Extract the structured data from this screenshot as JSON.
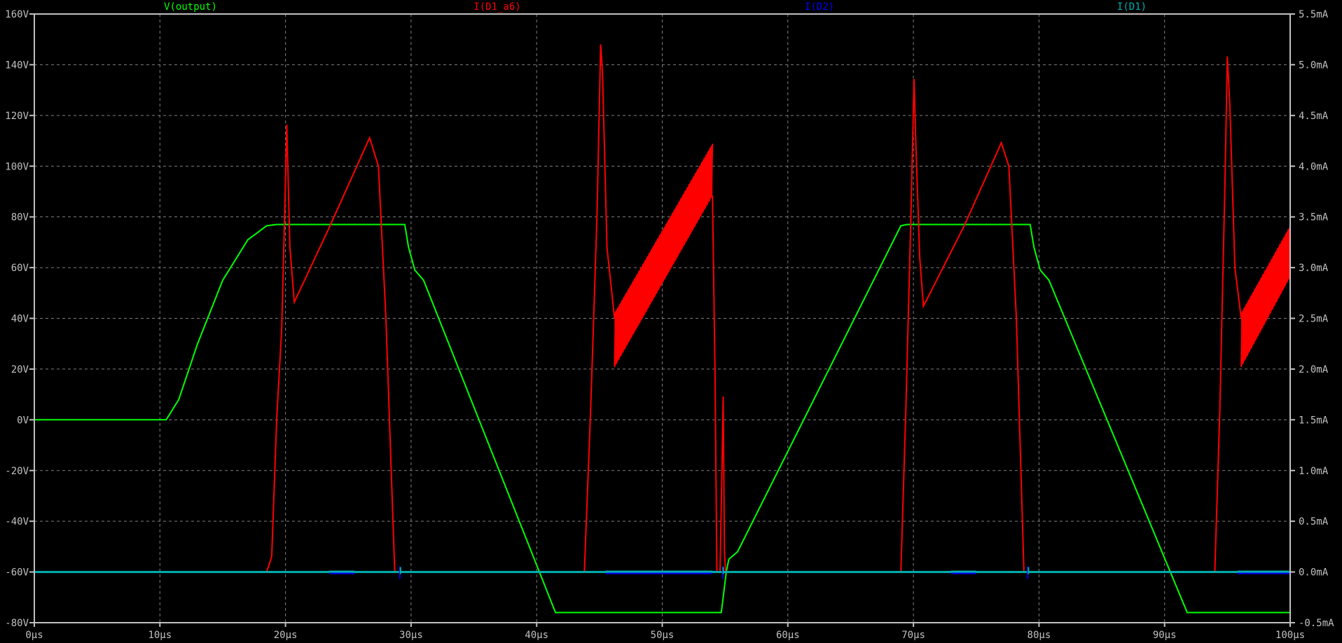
{
  "chart_data": {
    "type": "line",
    "title": "",
    "xlabel": "",
    "ylabel": "",
    "xlim": [
      0,
      100
    ],
    "ylim_left": [
      -80,
      160
    ],
    "ylim_right": [
      -0.5,
      5.5
    ],
    "grid": true,
    "legend_placement": "top",
    "x_ticks": [
      "0µs",
      "10µs",
      "20µs",
      "30µs",
      "40µs",
      "50µs",
      "60µs",
      "70µs",
      "80µs",
      "90µs",
      "100µs"
    ],
    "y_left_ticks": [
      "160V",
      "140V",
      "120V",
      "100V",
      "80V",
      "60V",
      "40V",
      "20V",
      "0V",
      "-20V",
      "-40V",
      "-60V",
      "-80V"
    ],
    "y_right_ticks": [
      "5.5mA",
      "5.0mA",
      "4.5mA",
      "4.0mA",
      "3.5mA",
      "3.0mA",
      "2.5mA",
      "2.0mA",
      "1.5mA",
      "1.0mA",
      "0.5mA",
      "0.0mA",
      "-0.5mA"
    ],
    "series": [
      {
        "name": "V(output)",
        "axis": "left",
        "unit": "V",
        "color": "#00ff00",
        "x": [
          0,
          10.5,
          11.5,
          13,
          15,
          17,
          18.5,
          19.3,
          29.5,
          29.8,
          30.3,
          31,
          41.5,
          54.7,
          54.9,
          55.1,
          55.3,
          56,
          69,
          69.5,
          79.3,
          79.6,
          80.1,
          80.8,
          91.8,
          92.5,
          100
        ],
        "y": [
          0,
          0,
          8,
          30,
          55,
          71,
          76.5,
          77,
          77,
          68,
          59,
          55,
          -76,
          -76,
          -68,
          -60,
          -55,
          -52,
          76.5,
          77,
          77,
          68,
          59,
          55,
          -76,
          -76,
          -76
        ]
      },
      {
        "name": "I(D1_a6)",
        "axis": "right",
        "unit": "mA",
        "color": "#ff0000",
        "x": [
          0,
          18.5,
          18.9,
          19.3,
          19.7,
          19.95,
          20.1,
          20.35,
          20.7,
          23.5,
          26.7,
          27.4,
          28,
          28.7,
          43.8,
          44.3,
          44.8,
          45.1,
          45.25,
          45.6,
          46.2
        ],
        "y": [
          0,
          0,
          0.15,
          1.5,
          2.4,
          3.6,
          4.41,
          3.2,
          2.66,
          3.4,
          4.28,
          4.0,
          2.5,
          0,
          0,
          1.6,
          3.5,
          5.2,
          4.9,
          3.2,
          2.5
        ]
      },
      {
        "name": "I(D1_a6) band 1",
        "axis": "right",
        "unit": "mA",
        "color": "#ff0000",
        "x": [
          46.2,
          54.0
        ],
        "upper": [
          2.55,
          4.22
        ],
        "lower": [
          2.02,
          3.71
        ]
      },
      {
        "name": "I(D1_a6) tail 1",
        "axis": "right",
        "unit": "mA",
        "color": "#ff0000",
        "x": [
          54.0,
          54.2,
          54.35,
          54.6,
          54.75,
          54.85,
          54.95,
          55.05,
          55.2,
          69.0,
          69.4,
          69.8,
          70.05,
          70.2,
          70.5,
          70.8,
          74,
          77,
          77.6,
          78.2,
          78.8,
          94.0,
          94.4,
          94.8,
          95.0,
          95.2,
          95.6,
          96.1
        ],
        "y": [
          3.71,
          2.0,
          0,
          0,
          1.0,
          1.73,
          0.2,
          0,
          0,
          0,
          1.6,
          3.5,
          4.86,
          4.2,
          3.1,
          2.62,
          3.4,
          4.23,
          4.0,
          2.5,
          0,
          0,
          1.6,
          3.8,
          5.08,
          4.6,
          3.0,
          2.5
        ]
      },
      {
        "name": "I(D1_a6) band 2",
        "axis": "right",
        "unit": "mA",
        "color": "#ff0000",
        "x": [
          96.1,
          100
        ],
        "upper": [
          2.55,
          3.41
        ],
        "lower": [
          2.02,
          2.91
        ]
      },
      {
        "name": "I(D2)",
        "axis": "right",
        "unit": "mA",
        "color": "#0000ff",
        "x": [
          0,
          100
        ],
        "y": [
          0,
          0
        ]
      },
      {
        "name": "I(D1)",
        "axis": "right",
        "unit": "mA",
        "color": "#00b0b0",
        "x": [
          0,
          100
        ],
        "y": [
          0,
          0
        ]
      }
    ]
  },
  "legend": {
    "v_output": "V(output)",
    "i_d1_a6": "I(D1_a6)",
    "i_d2": "I(D2)",
    "i_d1": "I(D1)"
  }
}
